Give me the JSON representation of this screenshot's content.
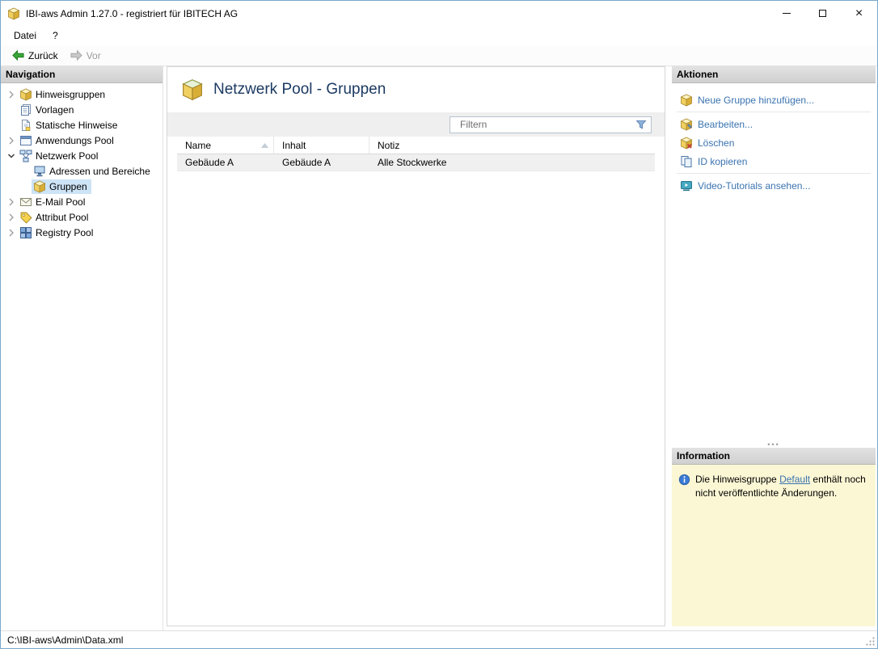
{
  "window": {
    "title": "IBI-aws Admin 1.27.0 - registriert für IBITECH AG"
  },
  "menubar": {
    "items": [
      {
        "label": "Datei"
      },
      {
        "label": "?"
      }
    ]
  },
  "toolbar": {
    "back": "Zurück",
    "forward": "Vor"
  },
  "navigation": {
    "title": "Navigation",
    "items": [
      {
        "label": "Hinweisgruppen"
      },
      {
        "label": "Vorlagen"
      },
      {
        "label": "Statische Hinweise"
      },
      {
        "label": "Anwendungs Pool"
      },
      {
        "label": "Netzwerk Pool"
      },
      {
        "label": "Adressen und Bereiche"
      },
      {
        "label": "Gruppen"
      },
      {
        "label": "E-Mail Pool"
      },
      {
        "label": "Attribut Pool"
      },
      {
        "label": "Registry Pool"
      }
    ]
  },
  "main": {
    "title": "Netzwerk Pool - Gruppen",
    "filter": {
      "placeholder": "Filtern"
    },
    "table": {
      "columns": [
        {
          "label": "Name"
        },
        {
          "label": "Inhalt"
        },
        {
          "label": "Notiz"
        }
      ],
      "rows": [
        {
          "name": "Gebäude A",
          "inhalt": "Gebäude A",
          "notiz": "Alle Stockwerke"
        }
      ]
    }
  },
  "actions": {
    "title": "Aktionen",
    "items": [
      {
        "label": "Neue Gruppe hinzufügen..."
      },
      {
        "label": "Bearbeiten..."
      },
      {
        "label": "Löschen"
      },
      {
        "label": "ID kopieren"
      },
      {
        "label": "Video-Tutorials ansehen..."
      }
    ]
  },
  "information": {
    "title": "Information",
    "text_before": "Die Hinweisgruppe ",
    "link_label": "Default",
    "text_after": " enthält noch nicht veröffentlichte Änderungen."
  },
  "statusbar": {
    "path": "C:\\IBI-aws\\Admin\\Data.xml"
  },
  "colors": {
    "link_blue": "#3a73b0",
    "info_bg": "#fbf7d5",
    "selection_bg": "#cde3f6",
    "header_gray": "#d5d5d5"
  }
}
